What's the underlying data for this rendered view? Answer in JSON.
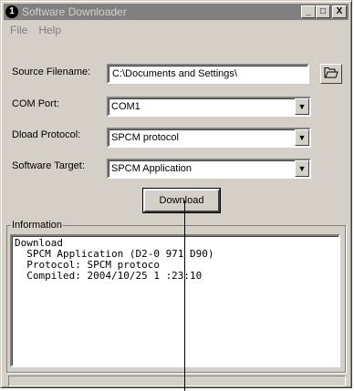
{
  "window": {
    "title": "Software Downloader",
    "icon_glyph": "1",
    "controls": [
      "_",
      "□",
      "X"
    ]
  },
  "menu": {
    "file": "File",
    "help": "Help"
  },
  "form": {
    "source_label": "Source Filename:",
    "source_value": "C:\\Documents and Settings\\",
    "com_label": "COM Port:",
    "com_value": "COM1",
    "protocol_label": "Dload Protocol:",
    "protocol_value": "SPCM protocol",
    "target_label": "Software Target:",
    "target_value": "SPCM Application",
    "browse_icon": "folder-open-icon"
  },
  "download_button": "Download",
  "information": {
    "label": "Information",
    "lines": [
      "Download",
      "  SPCM Application (D2-0 971 D90)",
      "  Protocol: SPCM protoco",
      "  Compiled: 2004/10/25 1 :23:10"
    ]
  }
}
